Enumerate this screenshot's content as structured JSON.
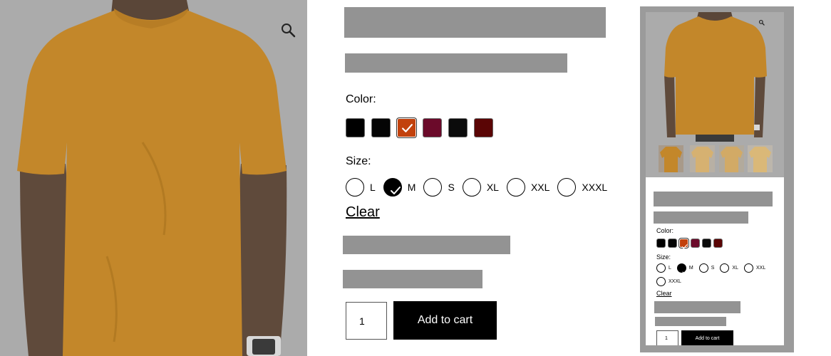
{
  "product": {
    "color_label": "Color:",
    "size_label": "Size:",
    "colors": [
      {
        "name": "black",
        "hex": "#000000",
        "selected": false
      },
      {
        "name": "black-2",
        "hex": "#050505",
        "selected": false
      },
      {
        "name": "orange",
        "hex": "#c2410c",
        "selected": true
      },
      {
        "name": "maroon",
        "hex": "#6b0a2a",
        "selected": false
      },
      {
        "name": "black-3",
        "hex": "#0b0b0b",
        "selected": false
      },
      {
        "name": "dark-red",
        "hex": "#5a0505",
        "selected": false
      }
    ],
    "sizes": [
      {
        "label": "L",
        "selected": false
      },
      {
        "label": "M",
        "selected": true
      },
      {
        "label": "S",
        "selected": false
      },
      {
        "label": "XL",
        "selected": false
      },
      {
        "label": "XXL",
        "selected": false
      },
      {
        "label": "XXXL",
        "selected": false
      }
    ],
    "clear_label": "Clear",
    "quantity": "1",
    "add_to_cart_label": "Add to cart"
  },
  "icons": {
    "zoom": "magnifier-icon",
    "selected_check": "checkmark-icon"
  },
  "colors": {
    "placeholder_bar": "#939393",
    "image_overlay": "#ababab",
    "shirt": "#c3872a",
    "button": "#000000"
  }
}
